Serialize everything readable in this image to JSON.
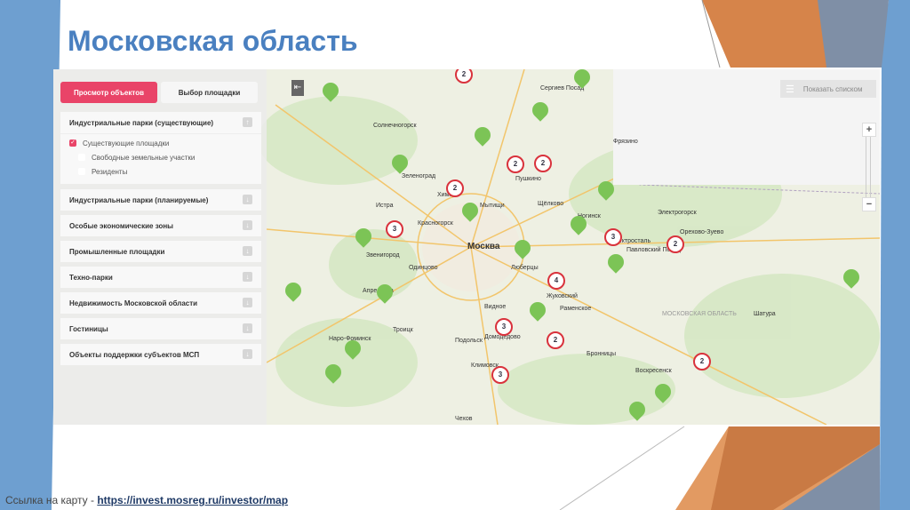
{
  "slide": {
    "title": "Московская область",
    "footer_label": "Ссылка на карту - ",
    "footer_link": "https://invest.mosreg.ru/investor/map"
  },
  "panel": {
    "tabs": [
      "Просмотр объектов",
      "Выбор площадки"
    ],
    "sections": [
      {
        "label": "Индустриальные парки (существующие)",
        "expanded": true
      },
      {
        "label": "Индустриальные парки (планируемые)"
      },
      {
        "label": "Особые экономические зоны"
      },
      {
        "label": "Промышленные площадки"
      },
      {
        "label": "Техно-парки"
      },
      {
        "label": "Недвижимость Московской области"
      },
      {
        "label": "Гостиницы"
      },
      {
        "label": "Объекты поддержки субъектов МСП"
      }
    ],
    "checkboxes": [
      {
        "label": "Существующие площадки",
        "checked": true
      },
      {
        "label": "Свободные земельные участки",
        "checked": false
      },
      {
        "label": "Резиденты",
        "checked": false
      }
    ]
  },
  "map": {
    "list_button": "Показать списком",
    "zoom_in": "+",
    "zoom_out": "−",
    "cities": [
      "Москва",
      "Химки",
      "Мытищи",
      "Красногорск",
      "Зеленоград",
      "Одинцово",
      "Люберцы",
      "Подольск",
      "Домодедово",
      "Жуковский",
      "Раменское",
      "Щёлково",
      "Ногинск",
      "Электросталь",
      "Орехово-Зуево",
      "Павловский Посад",
      "Сергиев Посад",
      "Истра",
      "Звенигород",
      "Апрелевка",
      "Наро-Фоминск",
      "Троицк",
      "Видное",
      "Климовск",
      "Чехов",
      "Пушкино",
      "Фрязино",
      "Электрогорск",
      "Шатура",
      "Воскресенск",
      "Бронницы",
      "Солнечногорск",
      "МОСКОВСКАЯ ОБЛАСТЬ"
    ],
    "clusters": [
      2,
      2,
      2,
      2,
      3,
      3,
      2,
      4,
      3,
      2,
      3,
      2
    ],
    "colors": {
      "cluster": "#d9323c",
      "pin": "#7cc456",
      "accent": "#e94468"
    }
  }
}
